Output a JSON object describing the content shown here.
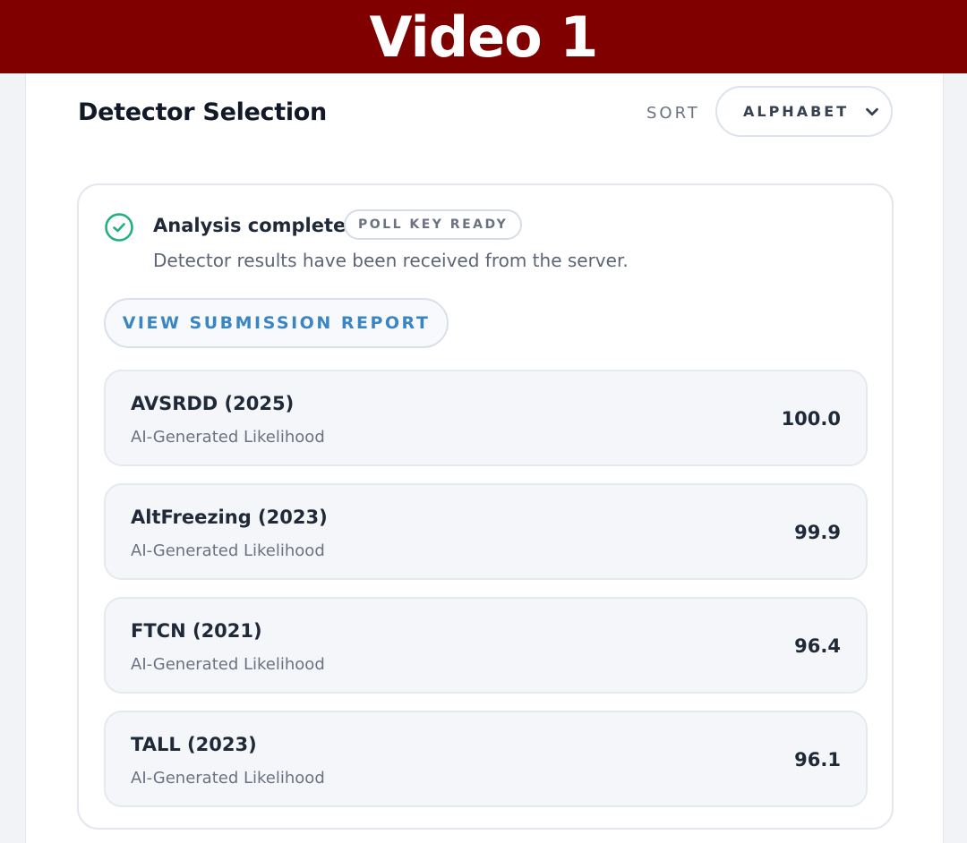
{
  "banner": {
    "title": "Video 1"
  },
  "section": {
    "title": "Detector Selection"
  },
  "sort": {
    "label": "SORT",
    "value": "ALPHABET"
  },
  "status": {
    "title": "Analysis complete",
    "badge": "POLL KEY READY",
    "description": "Detector results have been received from the server."
  },
  "report_button": {
    "label": "VIEW SUBMISSION REPORT"
  },
  "results": [
    {
      "name": "AVSRDD (2025)",
      "metric": "AI-Generated Likelihood",
      "score": "100.0"
    },
    {
      "name": "AltFreezing (2023)",
      "metric": "AI-Generated Likelihood",
      "score": "99.9"
    },
    {
      "name": "FTCN (2021)",
      "metric": "AI-Generated Likelihood",
      "score": "96.4"
    },
    {
      "name": "TALL (2023)",
      "metric": "AI-Generated Likelihood",
      "score": "96.1"
    }
  ],
  "colors": {
    "banner": "#800000",
    "success": "#22b07d",
    "accent": "#3a86c4"
  },
  "icons": {
    "status": "check-circle-icon",
    "select": "chevron-down-icon"
  }
}
